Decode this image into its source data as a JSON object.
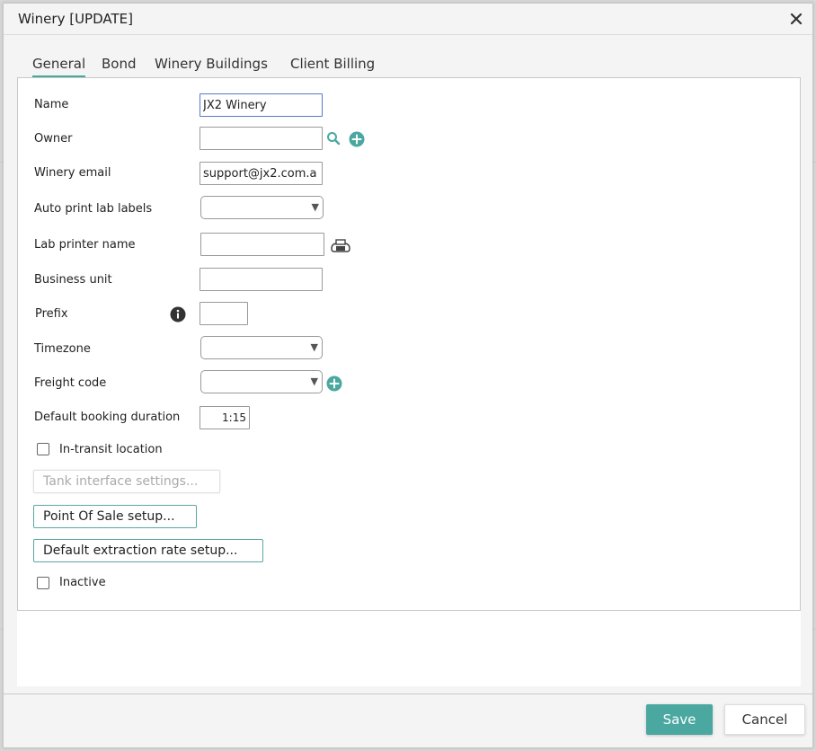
{
  "dialog": {
    "title": "Winery [UPDATE]"
  },
  "tabs": [
    {
      "label": "General",
      "active": true
    },
    {
      "label": "Bond",
      "active": false
    },
    {
      "label": "Winery Buildings",
      "active": false
    },
    {
      "label": "Client Billing",
      "active": false
    }
  ],
  "form": {
    "name": {
      "label": "Name",
      "value": "JX2 Winery"
    },
    "owner": {
      "label": "Owner",
      "value": ""
    },
    "winery_email": {
      "label": "Winery email",
      "value": "support@jx2.com.a"
    },
    "auto_print_lab_labels": {
      "label": "Auto print lab labels",
      "value": ""
    },
    "lab_printer_name": {
      "label": "Lab printer name",
      "value": ""
    },
    "business_unit": {
      "label": "Business unit",
      "value": ""
    },
    "prefix": {
      "label": "Prefix",
      "value": ""
    },
    "timezone": {
      "label": "Timezone",
      "value": ""
    },
    "freight_code": {
      "label": "Freight code",
      "value": ""
    },
    "default_booking_duration": {
      "label": "Default booking duration",
      "value": "1:15"
    },
    "in_transit_location": {
      "label": "In-transit location",
      "checked": false
    },
    "inactive": {
      "label": "Inactive",
      "checked": false
    }
  },
  "buttons": {
    "tank_interface_settings": "Tank interface settings...",
    "point_of_sale_setup": "Point Of Sale setup...",
    "default_extraction_rate_setup": "Default extraction rate setup...",
    "save": "Save",
    "cancel": "Cancel"
  },
  "icons": {
    "close": "close-icon",
    "owner_search": "search-icon",
    "owner_add": "add-circle-icon",
    "printer": "printer-icon",
    "prefix_info": "info-icon",
    "freight_add": "add-circle-icon"
  },
  "colors": {
    "accent": "#4aa8a0",
    "focus_border": "#5b79c9"
  }
}
